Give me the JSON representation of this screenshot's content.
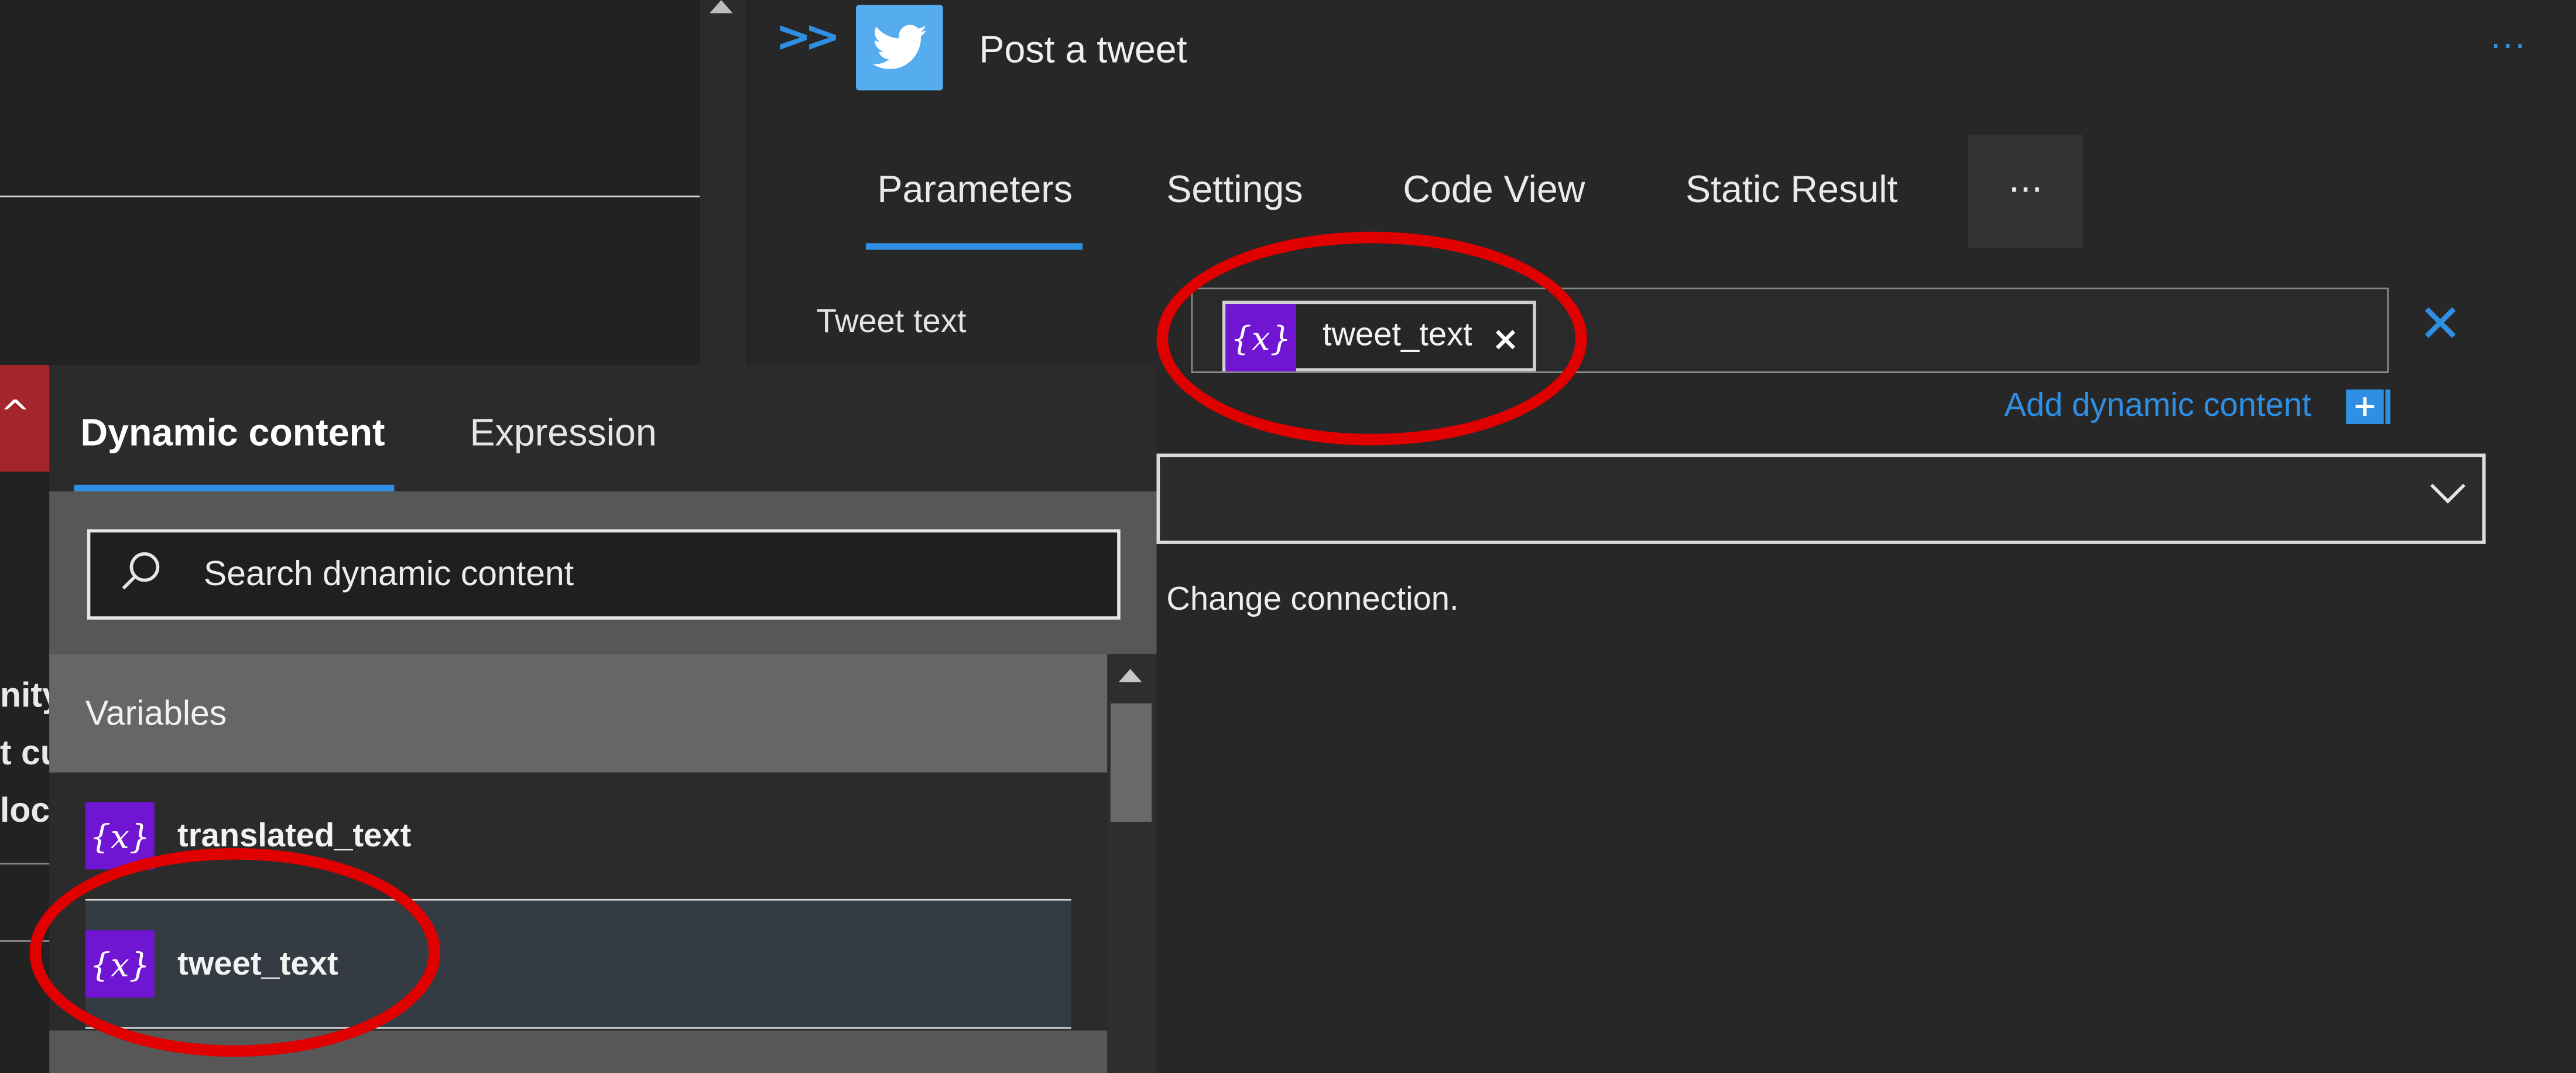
{
  "action": {
    "title": "Post a tweet",
    "more_label": "···",
    "tabs": [
      "Parameters",
      "Settings",
      "Code View",
      "Static Result"
    ],
    "tabs_more": "···"
  },
  "tweet_field": {
    "label": "Tweet text",
    "token_label": "tweet_text",
    "token_remove": "×",
    "clear": "✕",
    "add_dynamic": "Add dynamic content",
    "add_plus": "+"
  },
  "connection": {
    "change_text": "Change connection."
  },
  "left_canvas": {
    "fragments": [
      "nity",
      "t cu",
      "loc"
    ],
    "caret": "^"
  },
  "dynamic_panel": {
    "tabs": [
      "Dynamic content",
      "Expression"
    ],
    "search_placeholder": "Search dynamic content",
    "group_label": "Variables",
    "items": [
      {
        "label": "translated_text",
        "icon": "variable-icon"
      },
      {
        "label": "tweet_text",
        "icon": "variable-icon"
      }
    ],
    "var_icon_glyph": "{x}"
  },
  "colors": {
    "accent": "#2f8fe3",
    "variable": "#7016d3",
    "twitter": "#55acee",
    "annotation": "#e00000",
    "error_card": "#a4262c"
  }
}
